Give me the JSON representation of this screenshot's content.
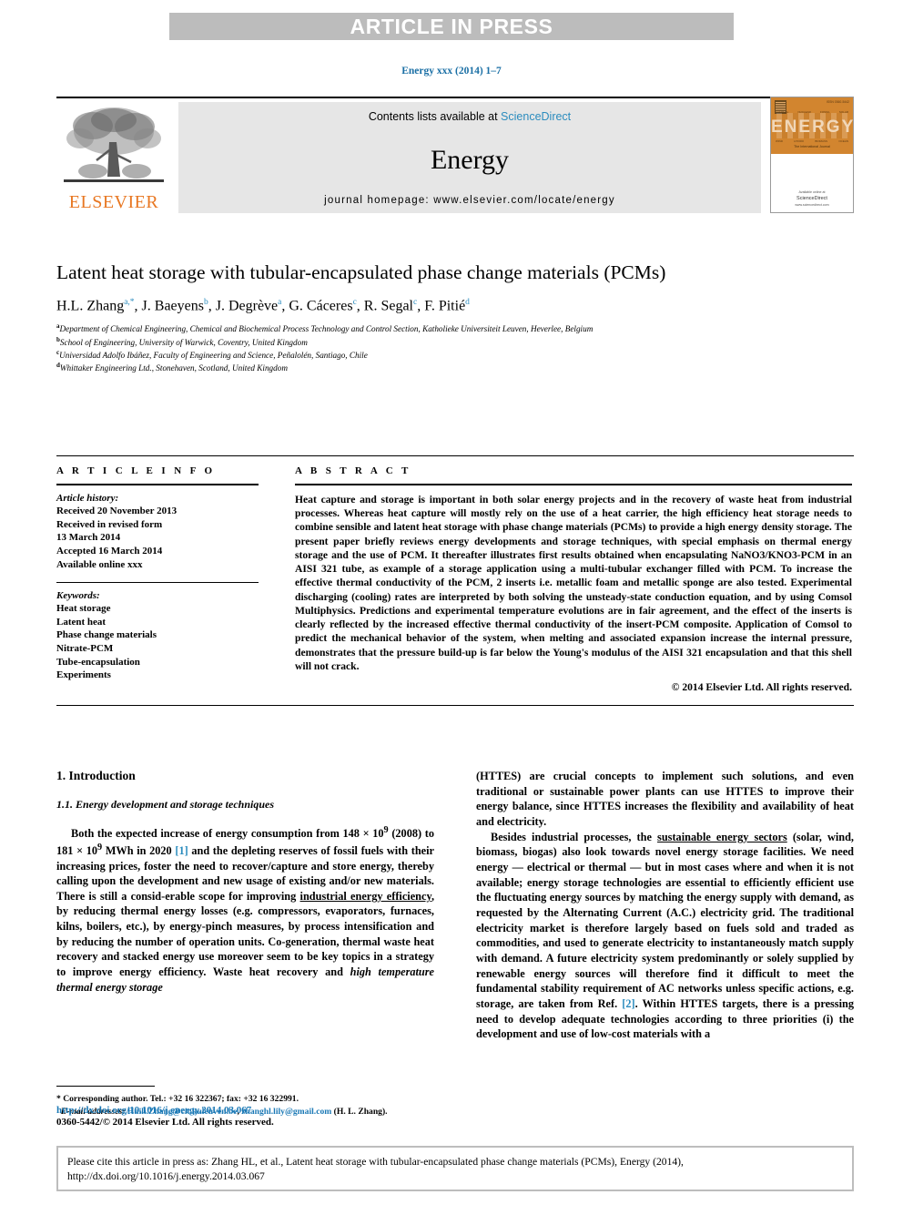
{
  "banner": {
    "label": "ARTICLE IN PRESS"
  },
  "running_head": "Energy xxx (2014) 1–7",
  "masthead": {
    "publisher": "ELSEVIER",
    "contents_prefix": "Contents lists available at ",
    "sciencedirect": "ScienceDirect",
    "journal_name": "Energy",
    "homepage": "journal homepage: www.elsevier.com/locate/energy",
    "cover": {
      "title": "ENERGY",
      "issn": "ISSN 0360-5442",
      "subtitle": "The International Journal",
      "labels_top": [
        "THERMAL",
        "NUCLEAR",
        "FOSSIL",
        "SOLAR"
      ],
      "labels_bottom": [
        "WIND",
        "HYDRO",
        "BIOMASS",
        "OCEAN"
      ],
      "foot_brand": "ScienceDirect",
      "foot_small": "Available online at",
      "foot_url": "www.sciencedirect.com"
    }
  },
  "article": {
    "title": "Latent heat storage with tubular-encapsulated phase change materials (PCMs)",
    "authors": [
      {
        "name": "H.L. Zhang",
        "marks": "a,*"
      },
      {
        "name": "J. Baeyens",
        "marks": "b"
      },
      {
        "name": "J. Degrève",
        "marks": "a"
      },
      {
        "name": "G. Cáceres",
        "marks": "c"
      },
      {
        "name": "R. Segal",
        "marks": "c"
      },
      {
        "name": "F. Pitié",
        "marks": "d"
      }
    ],
    "affiliations": [
      {
        "mark": "a",
        "text": "Department of Chemical Engineering, Chemical and Biochemical Process Technology and Control Section, Katholieke Universiteit Leuven, Heverlee, Belgium"
      },
      {
        "mark": "b",
        "text": "School of Engineering, University of Warwick, Coventry, United Kingdom"
      },
      {
        "mark": "c",
        "text": "Universidad Adolfo Ibáñez, Faculty of Engineering and Science, Peñalolén, Santiago, Chile"
      },
      {
        "mark": "d",
        "text": "Whittaker Engineering Ltd., Stonehaven, Scotland, United Kingdom"
      }
    ]
  },
  "article_info": {
    "heading": "A R T I C L E  I N F O",
    "history_label": "Article history:",
    "history": [
      "Received 20 November 2013",
      "Received in revised form",
      "13 March 2014",
      "Accepted 16 March 2014",
      "Available online xxx"
    ],
    "keywords_label": "Keywords:",
    "keywords": [
      "Heat storage",
      "Latent heat",
      "Phase change materials",
      "Nitrate-PCM",
      "Tube-encapsulation",
      "Experiments"
    ]
  },
  "abstract": {
    "heading": "A B S T R A C T",
    "text": "Heat capture and storage is important in both solar energy projects and in the recovery of waste heat from industrial processes. Whereas heat capture will mostly rely on the use of a heat carrier, the high efficiency heat storage needs to combine sensible and latent heat storage with phase change materials (PCMs) to provide a high energy density storage. The present paper briefly reviews energy developments and storage techniques, with special emphasis on thermal energy storage and the use of PCM. It thereafter illustrates first results obtained when encapsulating NaNO3/KNO3-PCM in an AISI 321 tube, as example of a storage application using a multi-tubular exchanger filled with PCM. To increase the effective thermal conductivity of the PCM, 2 inserts i.e. metallic foam and metallic sponge are also tested. Experimental discharging (cooling) rates are interpreted by both solving the unsteady-state conduction equation, and by using Comsol Multiphysics. Predictions and experimental temperature evolutions are in fair agreement, and the effect of the inserts is clearly reflected by the increased effective thermal conductivity of the insert-PCM composite. Application of Comsol to predict the mechanical behavior of the system, when melting and associated expansion increase the internal pressure, demonstrates that the pressure build-up is far below the Young's modulus of the AISI 321 encapsulation and that this shell will not crack.",
    "copyright": "© 2014 Elsevier Ltd. All rights reserved."
  },
  "body": {
    "section_number_title": "1.  Introduction",
    "subsection_title": "1.1.  Energy development and storage techniques",
    "left_para_1": "Both the expected increase of energy consumption from 148 × 10",
    "left_para_1b": " (2008) to 181 × 10",
    "left_para_1c": " MWh in 2020 ",
    "left_ref_1": "[1]",
    "left_para_1d": " and the depleting reserves of fossil fuels with their increasing prices, foster the need to recover/capture and store energy, thereby calling upon the development and new usage of existing and/or new materials. There is still a consid-erable scope for improving ",
    "left_underline_1": "industrial energy efficiency",
    "left_para_1e": ", by reducing thermal energy losses (e.g. compressors, evaporators, furnaces, kilns, boilers, etc.), by energy-pinch measures, by process intensification and by reducing the number of operation units. Co-generation, thermal waste heat recovery and stacked energy use moreover seem to be key topics in a strategy to improve energy efficiency. Waste heat recovery and ",
    "left_italic_1": "high temperature thermal energy storage",
    "right_para_1": "(HTTES) are crucial concepts to implement such solutions, and even traditional or sustainable power plants can use HTTES to improve their energy balance, since HTTES increases the flexibility and availability of heat and electricity.",
    "right_para_2a": "Besides industrial processes, the ",
    "right_underline_1": "sustainable energy sectors",
    "right_para_2b": " (solar, wind, biomass, biogas) also look towards novel energy storage facilities. We need energy — electrical or thermal — but in most cases where and when it is not available; energy storage technologies are essential to efficiently efficient use the fluctuating energy sources by matching the energy supply with demand, as requested by the Alternating Current (A.C.) electricity grid. The traditional electricity market is therefore largely based on fuels sold and traded as commodities, and used to generate electricity to instantaneously match supply with demand. A future electricity system predominantly or solely supplied by renewable energy sources will therefore find it difficult to meet the fundamental stability requirement of AC networks unless specific actions, e.g. storage, are taken from Ref. ",
    "right_ref_2": "[2]",
    "right_para_2c": ". Within HTTES targets, there is a pressing need to develop adequate technologies according to three priorities (i) the development and use of low-cost materials with a",
    "exp_9": "9"
  },
  "footnote": {
    "corresponding": "* Corresponding author. Tel.: +32 16 322367; fax: +32 16 322991.",
    "email_label": "E-mail addresses:",
    "email_1": "Huili.Zhang@cit.kuleuven.be",
    "email_sep": ", ",
    "email_2": "zhanghl.lily@gmail.com",
    "email_tail": " (H. L. Zhang)."
  },
  "footer": {
    "doi": "http://dx.doi.org/10.1016/j.energy.2014.03.067",
    "issn_line": "0360-5442/© 2014 Elsevier Ltd. All rights reserved."
  },
  "citation_box": {
    "text": "Please cite this article in press as: Zhang HL, et al., Latent heat storage with tubular-encapsulated phase change materials (PCMs), Energy (2014), http://dx.doi.org/10.1016/j.energy.2014.03.067"
  }
}
